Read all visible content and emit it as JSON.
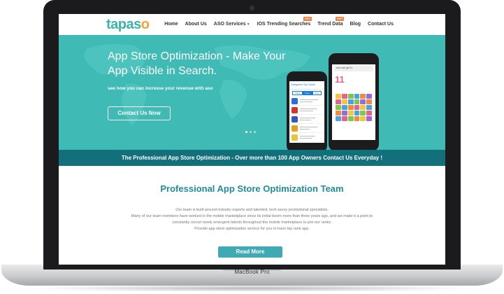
{
  "device": {
    "label": "MacBook Pro"
  },
  "nav": {
    "logo": "tapas",
    "logo_accent": "o",
    "items": [
      {
        "label": "Home"
      },
      {
        "label": "About Us"
      },
      {
        "label": "ASO Services",
        "has_dropdown": true
      },
      {
        "label": "IOS Trending Searches",
        "badge": "HOT"
      },
      {
        "label": "Trend Data",
        "badge": "HOT"
      },
      {
        "label": "Blog"
      },
      {
        "label": "Contact Us"
      }
    ]
  },
  "hero": {
    "title": "App Store Optimization - Make Your App Visible in Search.",
    "subtitle": "see how you can incresse your revenue with aso",
    "cta": "Contact Us Now",
    "slides": 3,
    "active_slide": 1,
    "phone_a": {
      "header": "Categories   Top Charts",
      "tabs": [
        "Paid",
        "Free",
        "Top"
      ],
      "active_tab": "Free"
    },
    "phone_b": {
      "search": "who can get 11",
      "big": "11"
    }
  },
  "banner": {
    "text": "The Professional App Store Optimization - Over more than 100 App Owners Contact Us Everyday !"
  },
  "team": {
    "title": "Professional App Store Optimization Team",
    "lines": [
      "Our team is built around industry experts and talented, tech savvy promotional specialists.",
      "Many of our team members have worked in the mobile marketplace since its initial boom more than three years ago, and we make it a point to",
      "constantly recruit newly emergent talents throughout the mobile marketplace to join our ranks.",
      "Provide app store optimization service for you to have top rank app."
    ],
    "button": "Read More"
  },
  "colors": {
    "brand": "#3fbab4",
    "banner": "#12707b",
    "title": "#1f8c9b",
    "accent": "#f0a531"
  }
}
